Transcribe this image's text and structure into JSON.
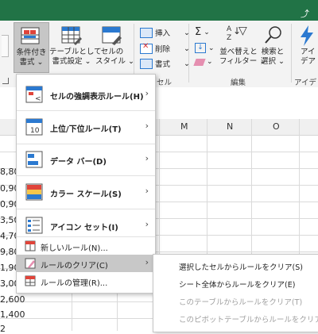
{
  "ribbon": {
    "cond_format_label_1": "条件付き",
    "cond_format_label_2": "書式",
    "table_format_label_1": "テーブルとして",
    "table_format_label_2": "書式設定",
    "cell_style_label_1": "セルの",
    "cell_style_label_2": "スタイル",
    "insert_label": "挿入",
    "delete_label": "削除",
    "format_label": "書式",
    "cells_group_label": "セル",
    "sort_label_1": "並べ替えと",
    "sort_label_2": "フィルター",
    "find_label_1": "検索と",
    "find_label_2": "選択",
    "edit_group_label": "編集",
    "ideas_label_1": "アイ",
    "ideas_label_2": "デア",
    "ideas_group_label": "アイデア"
  },
  "columns": [
    "M",
    "N",
    "O"
  ],
  "partial_cells": [
    "8,80",
    "0,90",
    "0,90",
    "3,50",
    "4,70",
    "9,80",
    "1,90",
    "3,00",
    "2,600",
    "1,400",
    "2"
  ],
  "menu": {
    "items": [
      {
        "label": "セルの強調表示ルール(H)"
      },
      {
        "label": "上位/下位ルール(T)"
      },
      {
        "label": "データ バー(D)"
      },
      {
        "label": "カラー スケール(S)"
      },
      {
        "label": "アイコン セット(I)"
      }
    ],
    "new_rule": "新しいルール(N)...",
    "clear_rules": "ルールのクリア(C)",
    "manage_rules": "ルールの管理(R)..."
  },
  "submenu": {
    "items": [
      {
        "label": "選択したセルからルールをクリア(S)",
        "enabled": true
      },
      {
        "label": "シート全体からルールをクリア(E)",
        "enabled": true
      },
      {
        "label": "このテーブルからルールをクリア(T)",
        "enabled": false
      },
      {
        "label": "このピボットテーブルからルールをクリア(P)",
        "enabled": false
      }
    ]
  },
  "colors": {
    "titlebar": "#217346",
    "accent": "#2b79d0",
    "hover": "#c8c8c8",
    "disabled": "#a0a0a0"
  }
}
